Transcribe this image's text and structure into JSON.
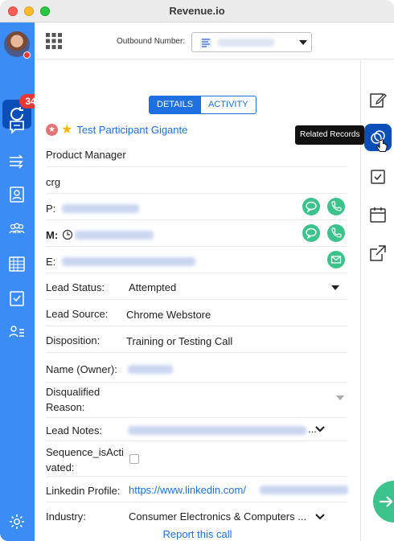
{
  "window": {
    "title": "Revenue.io"
  },
  "sidebar": {
    "badge_count": "34",
    "accent": "#3b8df5",
    "active_bg": "#0a4fb8"
  },
  "topbar": {
    "outbound_label": "Outbound Number:"
  },
  "tabs": [
    {
      "label": "DETAILS",
      "active": true
    },
    {
      "label": "ACTIVITY",
      "active": false
    }
  ],
  "contact": {
    "name": "Test Participant Gigante",
    "title": "Product Manager",
    "company": "crg"
  },
  "fields": {
    "phone_label": "P:",
    "mobile_label": "M:",
    "email_label": "E:",
    "lead_status_label": "Lead Status:",
    "lead_status_value": "Attempted",
    "lead_source_label": "Lead Source:",
    "lead_source_value": "Chrome Webstore",
    "disposition_label": "Disposition:",
    "disposition_value": "Training or Testing Call",
    "owner_label": "Name (Owner):",
    "disqualified_label_1": "Disqualified",
    "disqualified_label_2": "Reason:",
    "lead_notes_label": "Lead Notes:",
    "lead_notes_ellipsis": "...",
    "sequence_label_1": "Sequence_isActi",
    "sequence_label_2": "vated:",
    "linkedin_label": "Linkedin Profile:",
    "linkedin_value": "https://www.linkedin.com/",
    "industry_label": "Industry:",
    "industry_value": "Consumer Electronics & Computers ..."
  },
  "footer": {
    "report_link": "Report this call"
  },
  "rightbar": {
    "tooltip": "Related Records"
  },
  "colors": {
    "link": "#1e6fe0",
    "green": "#3cc38b",
    "badge_red": "#e53935"
  }
}
